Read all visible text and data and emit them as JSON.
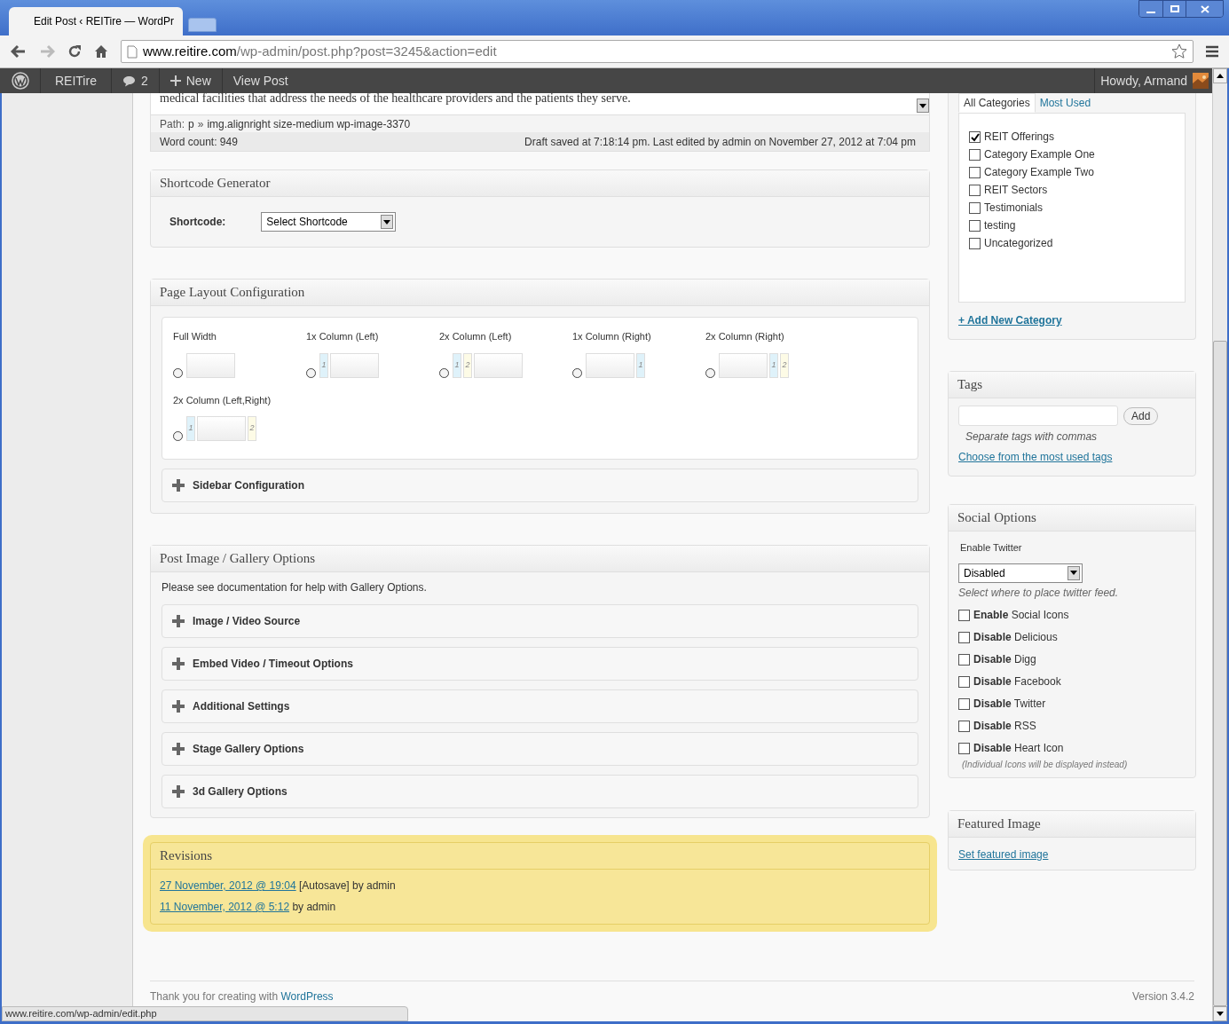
{
  "browser": {
    "tab_title": "Edit Post ‹ REITire — WordPr",
    "url_host": "www.reitire.com",
    "url_path": "/wp-admin/post.php?post=3245&action=edit",
    "status_url": "www.reitire.com/wp-admin/edit.php"
  },
  "admin_bar": {
    "site": "REITire",
    "comments": "2",
    "new": "New",
    "view": "View Post",
    "greeting": "Howdy, Armand"
  },
  "editor": {
    "text": "medical facilities that address the needs of the healthcare providers and the patients they serve.",
    "path_label": "Path:",
    "path": [
      "p",
      "img.alignright size-medium wp-image-3370"
    ],
    "path_separator": "»",
    "word_count": "Word count: 949",
    "status": "Draft saved at 7:18:14 pm. Last edited by admin on November 27, 2012 at 7:04 pm"
  },
  "shortcode": {
    "title": "Shortcode Generator",
    "label": "Shortcode:",
    "value": "Select Shortcode"
  },
  "layout": {
    "title": "Page Layout Configuration",
    "options": [
      {
        "label": "Full Width",
        "selected": false,
        "cells": [
          {
            "kind": "main"
          }
        ]
      },
      {
        "label": "1x Column (Left)",
        "selected": false,
        "cells": [
          {
            "kind": "side",
            "text": "1",
            "color": "#dff2fa"
          },
          {
            "kind": "main"
          }
        ]
      },
      {
        "label": "2x Column (Left)",
        "selected": false,
        "cells": [
          {
            "kind": "side",
            "text": "1",
            "color": "#dff2fa"
          },
          {
            "kind": "side",
            "text": "2",
            "color": "#fdfbe6"
          },
          {
            "kind": "main"
          }
        ]
      },
      {
        "label": "1x Column (Right)",
        "selected": false,
        "cells": [
          {
            "kind": "main"
          },
          {
            "kind": "side",
            "text": "1",
            "color": "#dff2fa"
          }
        ]
      },
      {
        "label": "2x Column (Right)",
        "selected": false,
        "cells": [
          {
            "kind": "main"
          },
          {
            "kind": "side",
            "text": "1",
            "color": "#dff2fa"
          },
          {
            "kind": "side",
            "text": "2",
            "color": "#fdfbe6"
          }
        ]
      },
      {
        "label": "2x Column (Left,Right)",
        "selected": false,
        "cells": [
          {
            "kind": "side",
            "text": "1",
            "color": "#dff2fa"
          },
          {
            "kind": "main"
          },
          {
            "kind": "side",
            "text": "2",
            "color": "#fdfbe6"
          }
        ]
      }
    ],
    "toggle": "Sidebar Configuration"
  },
  "gallery": {
    "title": "Post Image / Gallery Options",
    "note": "Please see documentation for help with Gallery Options.",
    "sections": [
      "Image / Video Source",
      "Embed Video / Timeout Options",
      "Additional Settings",
      "Stage Gallery Options",
      "3d Gallery Options"
    ]
  },
  "revisions": {
    "title": "Revisions",
    "items": [
      {
        "link": "27 November, 2012 @ 19:04",
        "text": "[Autosave] by admin"
      },
      {
        "link": "11 November, 2012 @ 5:12",
        "text": "by admin"
      }
    ]
  },
  "footer": {
    "thanks": "Thank you for creating with",
    "link": "WordPress",
    "version": "Version 3.4.2"
  },
  "categories": {
    "tabs": [
      {
        "label": "All Categories",
        "selected": true
      },
      {
        "label": "Most Used",
        "selected": false
      }
    ],
    "items": [
      {
        "label": "REIT Offerings",
        "checked": true
      },
      {
        "label": "Category Example One",
        "checked": false
      },
      {
        "label": "Category Example Two",
        "checked": false
      },
      {
        "label": "REIT Sectors",
        "checked": false
      },
      {
        "label": "Testimonials",
        "checked": false
      },
      {
        "label": "testing",
        "checked": false
      },
      {
        "label": "Uncategorized",
        "checked": false
      }
    ],
    "add": "+ Add New Category"
  },
  "tags": {
    "title": "Tags",
    "button": "Add",
    "hint": "Separate tags with commas",
    "link": "Choose from the most used tags"
  },
  "social": {
    "title": "Social Options",
    "twitter_label": "Enable Twitter",
    "twitter_value": "Disabled",
    "twitter_hint": "Select where to place twitter feed.",
    "options": [
      {
        "label": "**Enable** Social Icons",
        "checked": false
      },
      {
        "label": "**Disable** Delicious",
        "checked": false
      },
      {
        "label": "**Disable** Digg",
        "checked": false
      },
      {
        "label": "**Disable** Facebook",
        "checked": false
      },
      {
        "label": "**Disable** Twitter",
        "checked": false
      },
      {
        "label": "**Disable** RSS",
        "checked": false
      },
      {
        "label": "**Disable** Heart Icon",
        "checked": false
      }
    ],
    "note": "(Individual Icons will be displayed instead)"
  },
  "featured": {
    "title": "Featured Image",
    "link": "Set featured image"
  }
}
